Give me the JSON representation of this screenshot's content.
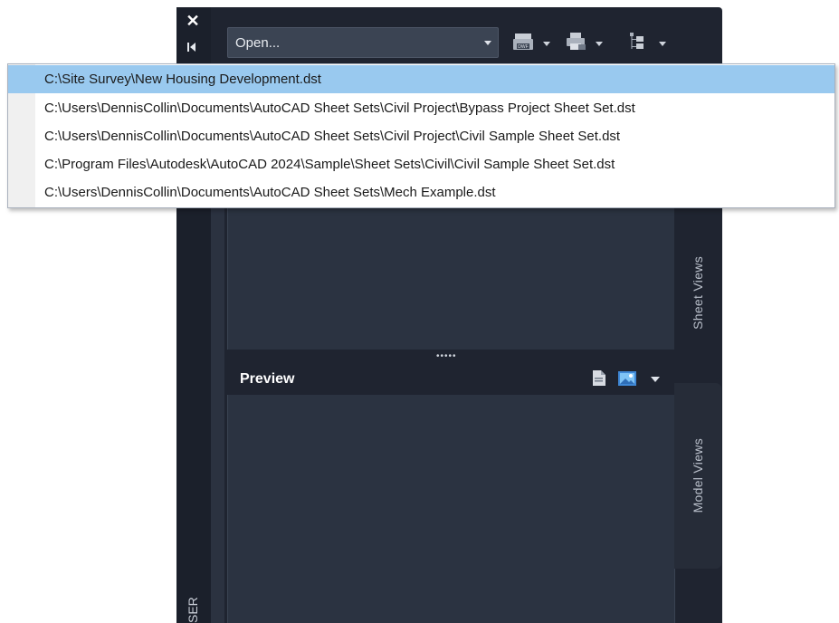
{
  "palette": {
    "title": "SER",
    "open_combo": {
      "label": "Open..."
    }
  },
  "preview": {
    "title": "Preview"
  },
  "side_tabs": [
    {
      "label": "Sheet Views"
    },
    {
      "label": "Model Views"
    }
  ],
  "recent_sheet_sets": [
    {
      "path": "C:\\Site Survey\\New Housing Development.dst",
      "selected": true
    },
    {
      "path": "C:\\Users\\DennisCollin\\Documents\\AutoCAD Sheet Sets\\Civil Project\\Bypass Project Sheet Set.dst",
      "selected": false
    },
    {
      "path": "C:\\Users\\DennisCollin\\Documents\\AutoCAD Sheet Sets\\Civil Project\\Civil Sample Sheet Set.dst",
      "selected": false
    },
    {
      "path": "C:\\Program Files\\Autodesk\\AutoCAD 2024\\Sample\\Sheet Sets\\Civil\\Civil Sample Sheet Set.dst",
      "selected": false
    },
    {
      "path": "C:\\Users\\DennisCollin\\Documents\\AutoCAD Sheet Sets\\Mech Example.dst",
      "selected": false
    }
  ],
  "icons": {
    "close": "close-icon",
    "autohide": "autohide-icon",
    "publish_dwf": "publish-dwf-icon",
    "print": "print-icon",
    "subset": "sheet-subset-icon",
    "preview_page": "page-icon",
    "preview_image": "image-icon"
  },
  "colors": {
    "palette_bg": "#1f2430",
    "pane_bg": "#2b3341",
    "selection": "#99c9ef"
  }
}
